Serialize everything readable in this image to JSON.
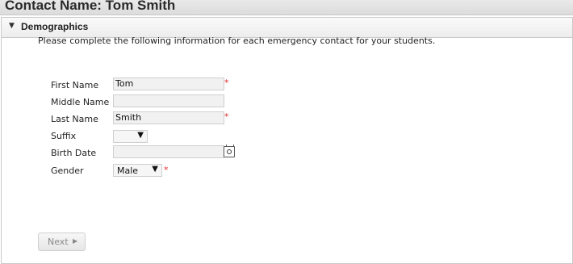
{
  "page": {
    "title": "Contact Name: Tom Smith"
  },
  "section": {
    "title": "Demographics",
    "instructions": "Please complete the following information for each emergency contact for your students."
  },
  "form": {
    "first_name": {
      "label": "First Name",
      "value": "Tom",
      "required_mark": "*"
    },
    "middle_name": {
      "label": "Middle Name",
      "value": ""
    },
    "last_name": {
      "label": "Last Name",
      "value": "Smith",
      "required_mark": "*"
    },
    "suffix": {
      "label": "Suffix",
      "value": ""
    },
    "birth_date": {
      "label": "Birth Date",
      "value": ""
    },
    "gender": {
      "label": "Gender",
      "value": "Male",
      "required_mark": "*"
    }
  },
  "actions": {
    "next_label": "Next"
  },
  "icons": {
    "section_toggle": "caret-down-icon",
    "select_arrow": "triangle-down-icon",
    "date_picker": "calendar-icon",
    "next_arrow": "triangle-right-icon"
  },
  "colors": {
    "required": "#e03030",
    "input_bg": "#f1f1f1",
    "disabled_text": "#888888"
  }
}
